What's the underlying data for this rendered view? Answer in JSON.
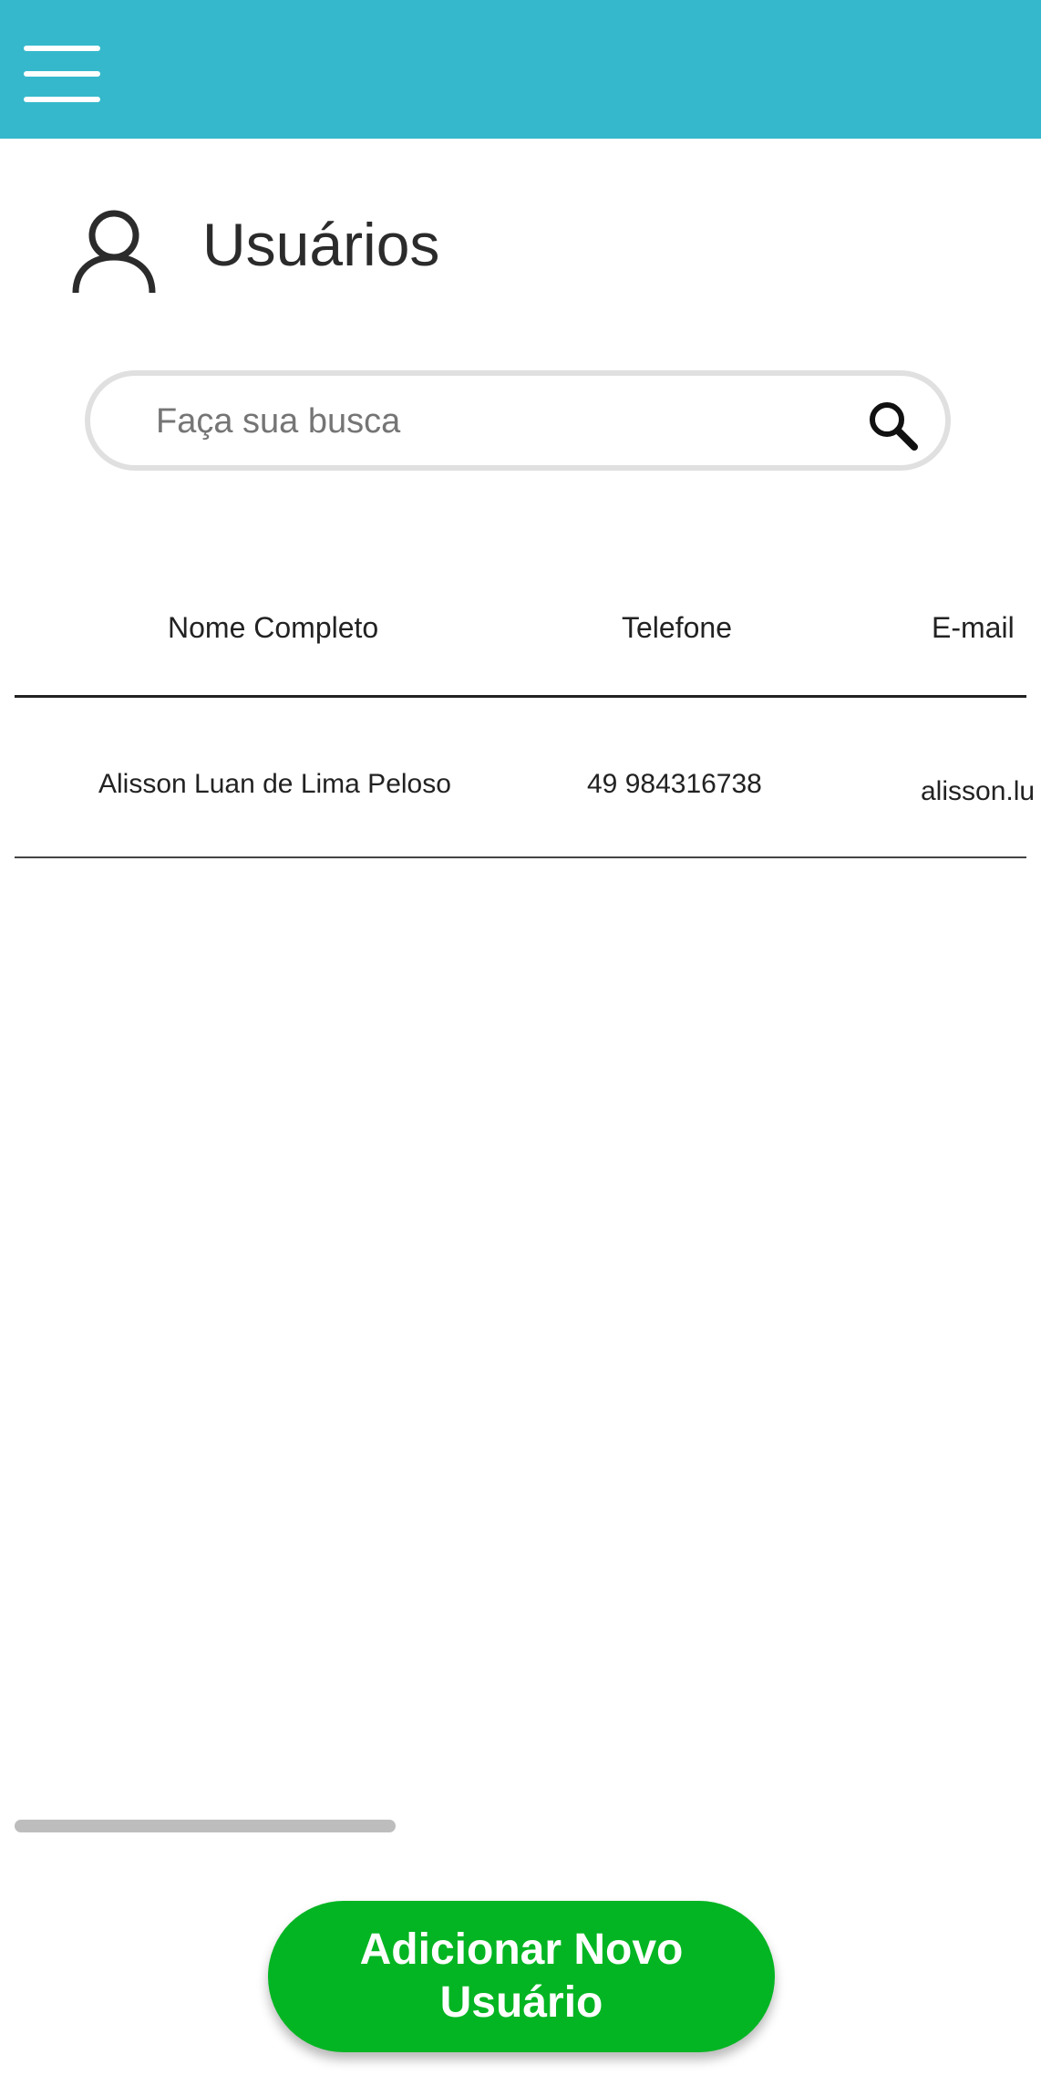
{
  "theme": {
    "accent": "#35B8CC",
    "primary": "#03B522"
  },
  "header": {
    "menu_icon": "hamburger-menu-icon"
  },
  "page": {
    "title": "Usuários",
    "title_icon": "user-icon"
  },
  "search": {
    "placeholder": "Faça sua busca",
    "value": "",
    "icon": "search-icon"
  },
  "table": {
    "columns": [
      "Nome Completo",
      "Telefone",
      "E-mail"
    ],
    "rows": [
      {
        "name": "Alisson Luan de Lima Peloso",
        "phone": "49 984316738",
        "email": "alisson.lu"
      }
    ]
  },
  "scrollbar": {
    "position_fraction": 0.0,
    "visible_fraction": 0.37
  },
  "actions": {
    "add_user_label": "Adicionar Novo Usuário"
  }
}
